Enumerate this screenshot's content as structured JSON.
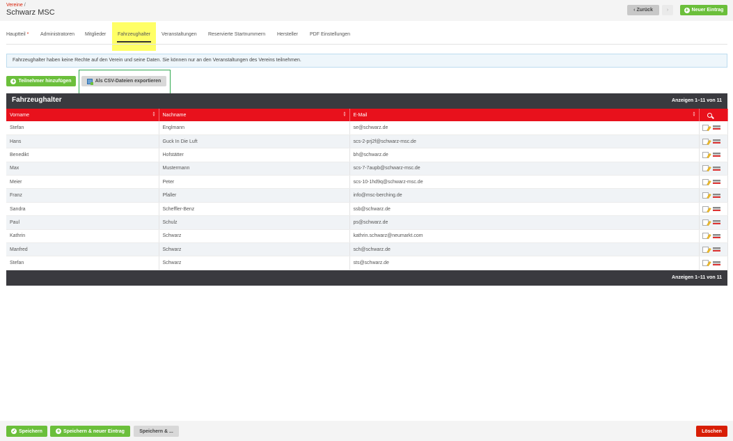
{
  "header": {
    "breadcrumb": "Vereine",
    "breadcrumb_sep": "/",
    "title": "Schwarz MSC",
    "back_label": "Zurück",
    "forward_label": "›",
    "new_entry_label": "Neuer Eintrag"
  },
  "tabs": [
    {
      "label": "Hauptteil",
      "required": "*"
    },
    {
      "label": "Administratoren"
    },
    {
      "label": "Mitglieder"
    },
    {
      "label": "Fahrzeughalter"
    },
    {
      "label": "Veranstaltungen"
    },
    {
      "label": "Reservierte Startnummern"
    },
    {
      "label": "Hersteller"
    },
    {
      "label": "PDF Einstellungen"
    }
  ],
  "info_text": "Fahrzeughalter haben keine Rechte auf den Verein und seine Daten. Sie können nur an den Veranstaltungen des Vereins teilnehmen.",
  "actions": {
    "add_participant": "Teilnehmer hinzufügen",
    "export_csv": "Als CSV-Dateien exportieren"
  },
  "panel": {
    "title": "Fahrzeughalter",
    "count_label": "Anzeigen 1–11 von 11"
  },
  "table": {
    "columns": [
      "Vorname",
      "Nachname",
      "E-Mail"
    ],
    "rows": [
      [
        "Stefan",
        "Englmann",
        "se@schwarz.de"
      ],
      [
        "Hans",
        "Guck In Die Luft",
        "scs-2-prj2f@schwarz-msc.de"
      ],
      [
        "Benedikt",
        "Hofstätter",
        "bh@schwarz.de"
      ],
      [
        "Max",
        "Mustermann",
        "scs-7-7aupb@schwarz-msc.de"
      ],
      [
        "Meier",
        "Peter",
        "scs-10-1hd9q@schwarz-msc.de"
      ],
      [
        "Franz",
        "Pfaller",
        "info@msc-berching.de"
      ],
      [
        "Sandra",
        "Scheffler-Benz",
        "ssb@schwarz.de"
      ],
      [
        "Paul",
        "Schulz",
        "ps@schwarz.de"
      ],
      [
        "Kathrin",
        "Schwarz",
        "kathrin.schwarz@neumarkt.com"
      ],
      [
        "Manfred",
        "Schwarz",
        "sch@schwarz.de"
      ],
      [
        "Stefan",
        "Schwarz",
        "sts@schwarz.de"
      ]
    ]
  },
  "footer": {
    "save": "Speichern",
    "save_new": "Speichern & neuer Eintrag",
    "save_as": "Speichern & ...",
    "delete": "Löschen"
  },
  "colors": {
    "accent_red": "#e8111c",
    "green": "#6bbf3b",
    "dark": "#3a3a3f",
    "highlight": "#ffff66"
  }
}
